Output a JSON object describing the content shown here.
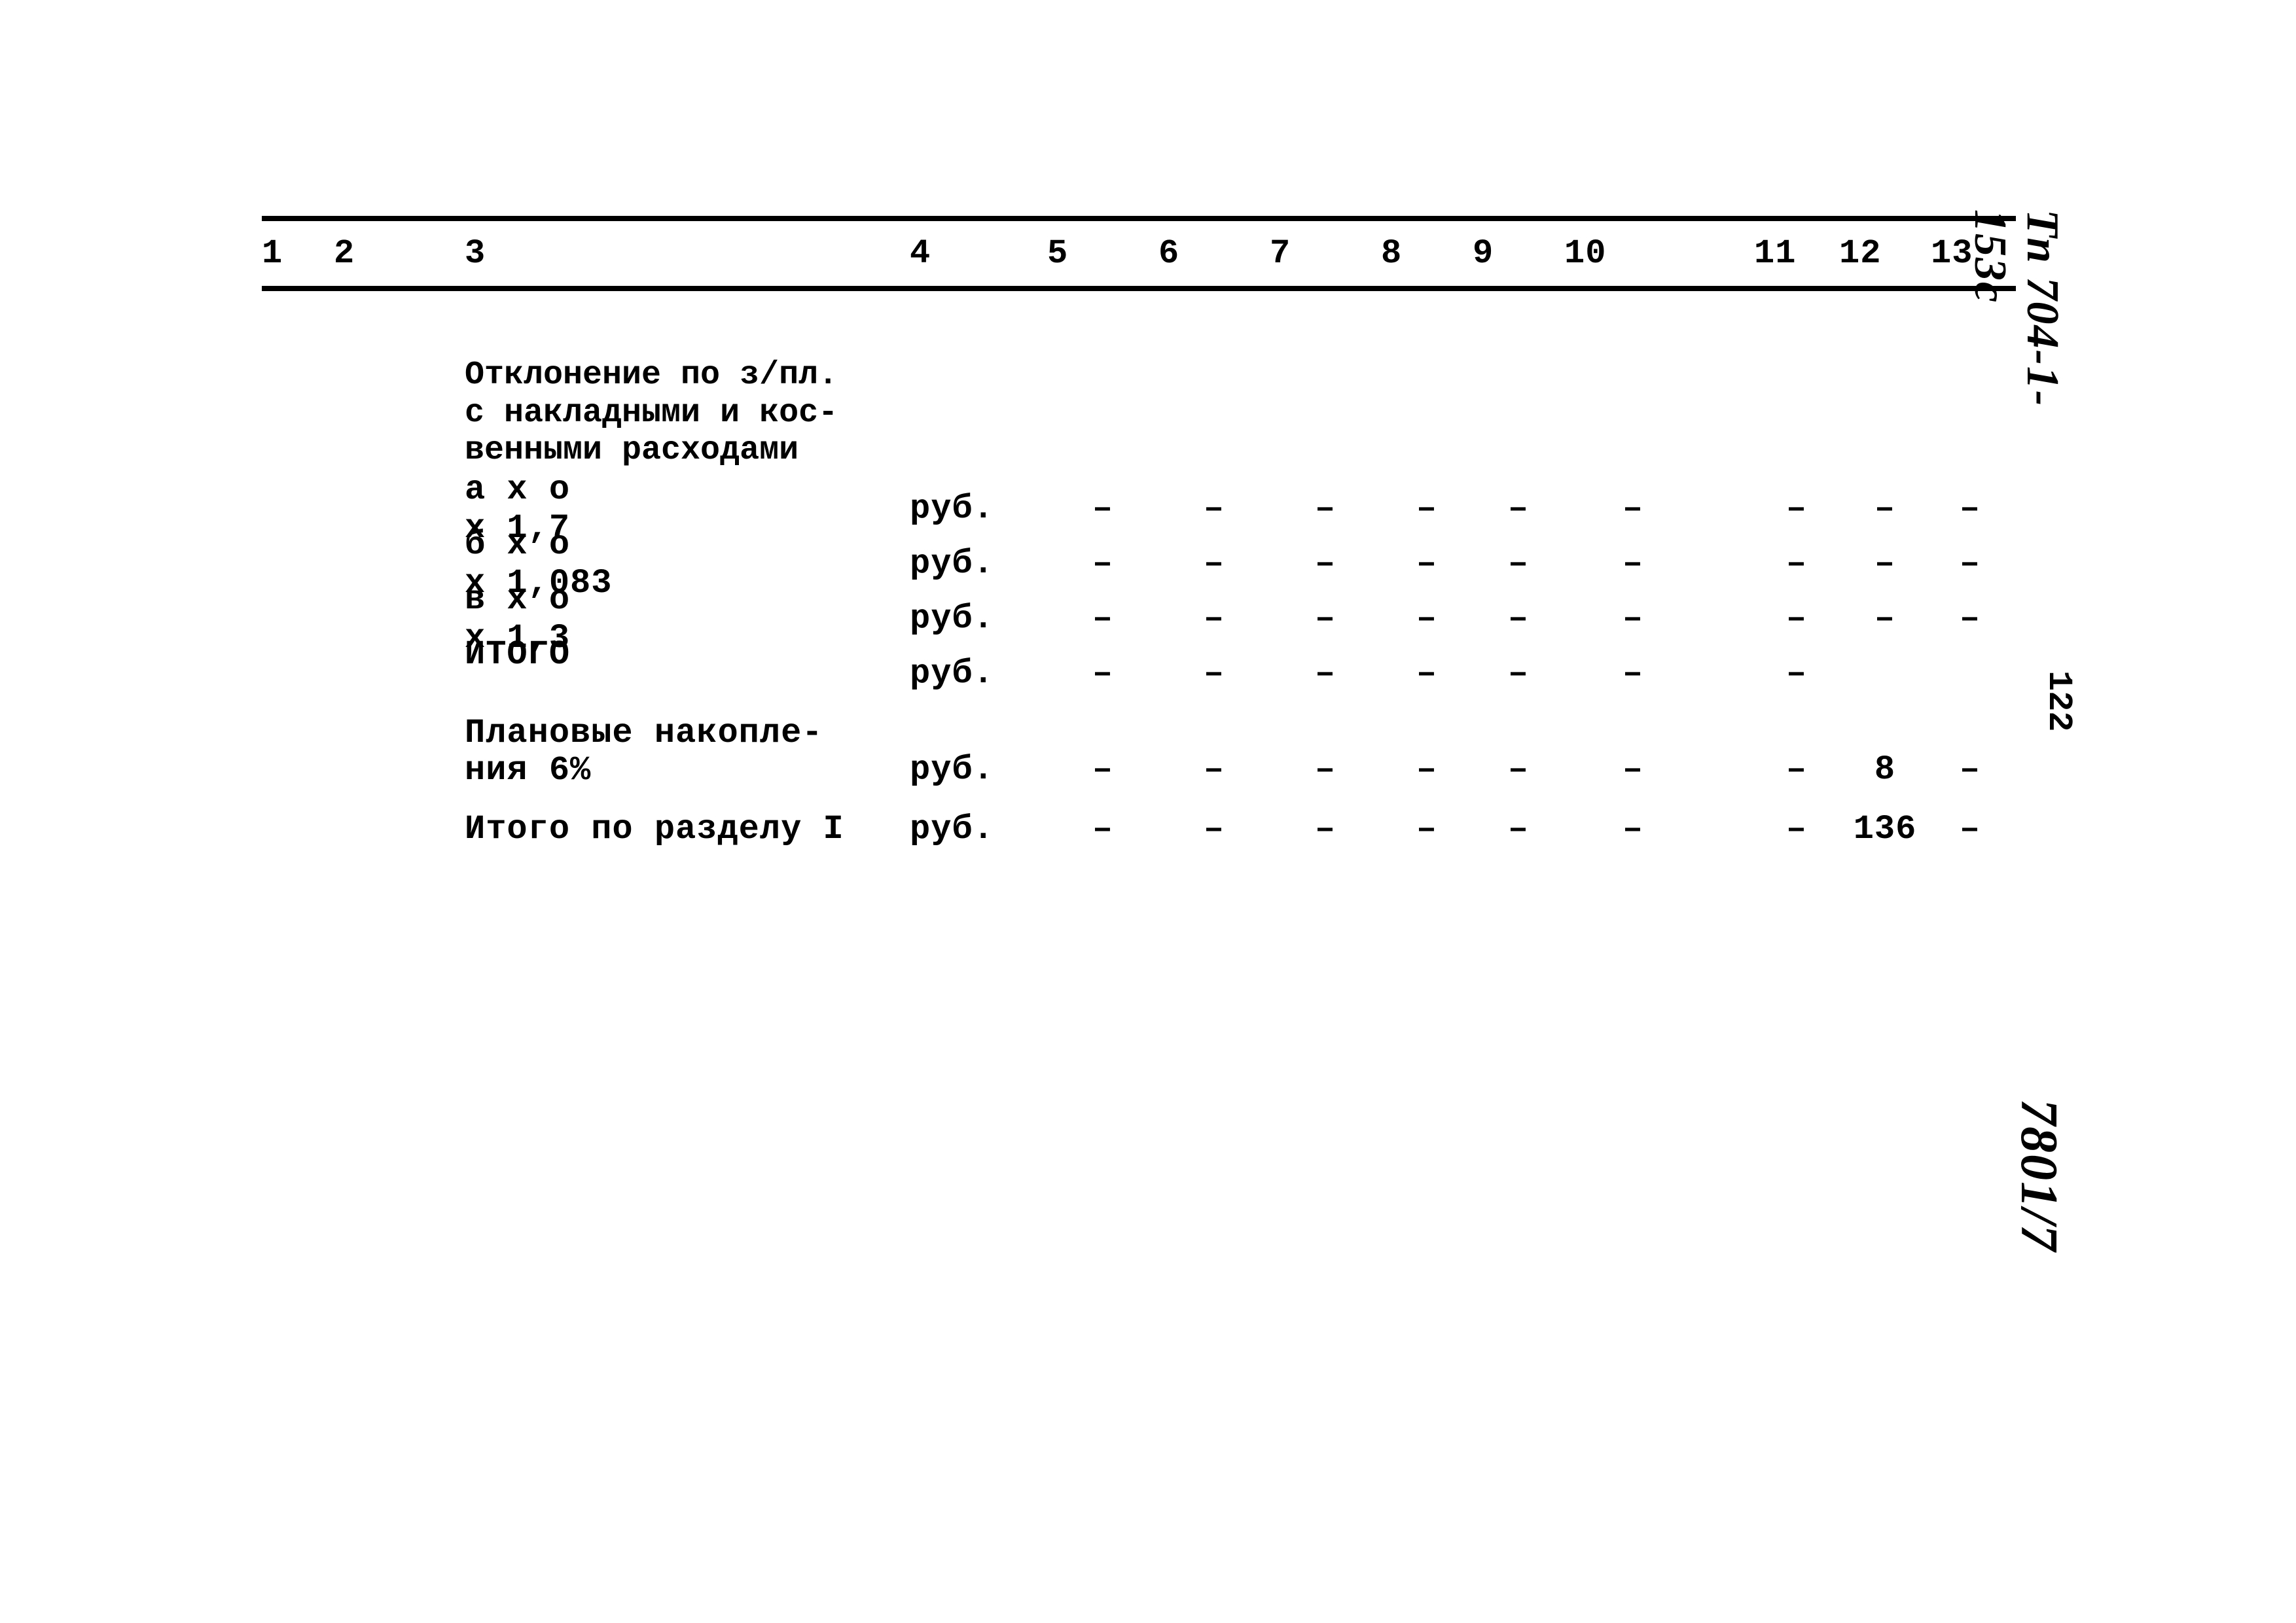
{
  "margin": {
    "doc_code": "Тп 704-1-153с",
    "page_number": "122",
    "archive_code": "7801/7"
  },
  "header": {
    "c1": "1",
    "c2": "2",
    "c3": "3",
    "c4": "4",
    "c5": "5",
    "c6": "6",
    "c7": "7",
    "c8": "8",
    "c9": "9",
    "c10": "10",
    "c11": "11",
    "c12": "12",
    "c13": "13"
  },
  "section": {
    "title_l1": "Отклонение по з/пл.",
    "title_l2": "с накладными и кос-",
    "title_l3": "венными расходами"
  },
  "rows": [
    {
      "label_a": "а х о",
      "label_b": "х 1,7",
      "unit": "руб.",
      "v5": "–",
      "v6": "–",
      "v7": "–",
      "v8": "–",
      "v9": "–",
      "v10": "–",
      "v11": "–",
      "v12": "–",
      "v13": "–"
    },
    {
      "label_a": "б х о",
      "label_b": "х 1,083",
      "unit": "руб.",
      "v5": "–",
      "v6": "–",
      "v7": "–",
      "v8": "–",
      "v9": "–",
      "v10": "–",
      "v11": "–",
      "v12": "–",
      "v13": "–"
    },
    {
      "label_a": "в х о",
      "label_b": "х 1,3",
      "unit": "руб.",
      "v5": "–",
      "v6": "–",
      "v7": "–",
      "v8": "–",
      "v9": "–",
      "v10": "–",
      "v11": "–",
      "v12": "–",
      "v13": "–"
    },
    {
      "label_a": "ИТОГО",
      "label_b": "",
      "unit": "руб.",
      "v5": "–",
      "v6": "–",
      "v7": "–",
      "v8": "–",
      "v9": "–",
      "v10": "–",
      "v11": "–",
      "v12": "",
      "v13": ""
    }
  ],
  "plan": {
    "title_l1": "Плановые накопле-",
    "title_l2": "ния 6%",
    "unit": "руб.",
    "v5": "–",
    "v6": "–",
    "v7": "–",
    "v8": "–",
    "v9": "–",
    "v10": "–",
    "v11": "–",
    "v12": "8",
    "v13": "–"
  },
  "total": {
    "label": "Итого по разделу I",
    "unit": "руб.",
    "v5": "–",
    "v6": "–",
    "v7": "–",
    "v8": "–",
    "v9": "–",
    "v10": "–",
    "v11": "–",
    "v12": "136",
    "v13": "–"
  }
}
